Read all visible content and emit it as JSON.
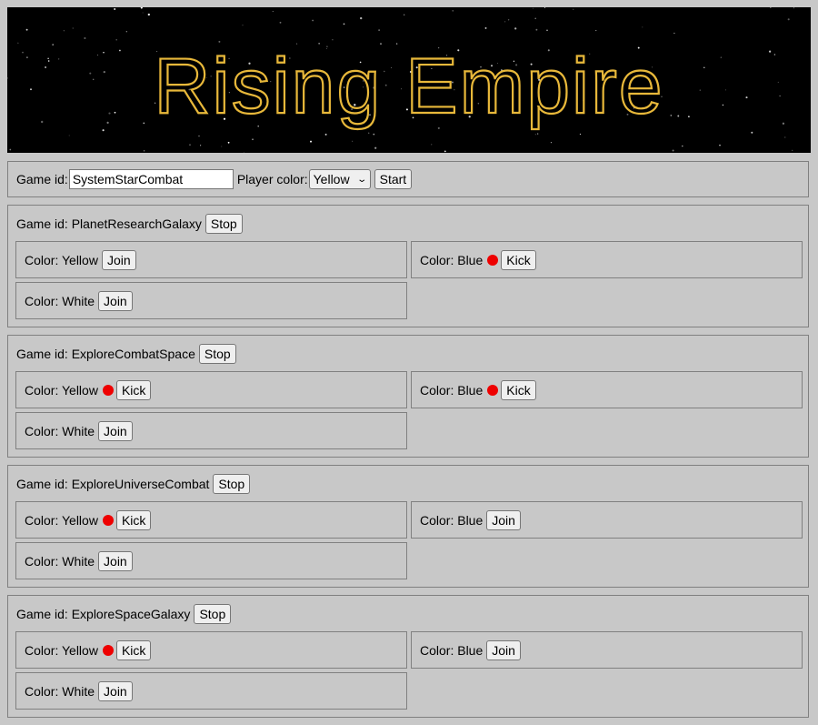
{
  "banner": {
    "title": "Rising Empire",
    "accent_color": "#e8b83a"
  },
  "new_game": {
    "game_id_label": "Game id:",
    "game_id_value": "SystemStarCombat",
    "player_color_label": "Player color:",
    "player_color_selected": "Yellow",
    "start_label": "Start"
  },
  "games": [
    {
      "label": "Game id: PlanetResearchGalaxy",
      "stop_label": "Stop",
      "slots": [
        {
          "label": "Color: Yellow",
          "occupied": false,
          "action": "Join"
        },
        {
          "label": "Color: Blue",
          "occupied": true,
          "action": "Kick"
        },
        {
          "label": "Color: White",
          "occupied": false,
          "action": "Join"
        }
      ]
    },
    {
      "label": "Game id: ExploreCombatSpace",
      "stop_label": "Stop",
      "slots": [
        {
          "label": "Color: Yellow",
          "occupied": true,
          "action": "Kick"
        },
        {
          "label": "Color: Blue",
          "occupied": true,
          "action": "Kick"
        },
        {
          "label": "Color: White",
          "occupied": false,
          "action": "Join"
        }
      ]
    },
    {
      "label": "Game id: ExploreUniverseCombat",
      "stop_label": "Stop",
      "slots": [
        {
          "label": "Color: Yellow",
          "occupied": true,
          "action": "Kick"
        },
        {
          "label": "Color: Blue",
          "occupied": false,
          "action": "Join"
        },
        {
          "label": "Color: White",
          "occupied": false,
          "action": "Join"
        }
      ]
    },
    {
      "label": "Game id: ExploreSpaceGalaxy",
      "stop_label": "Stop",
      "slots": [
        {
          "label": "Color: Yellow",
          "occupied": true,
          "action": "Kick"
        },
        {
          "label": "Color: Blue",
          "occupied": false,
          "action": "Join"
        },
        {
          "label": "Color: White",
          "occupied": false,
          "action": "Join"
        }
      ]
    }
  ],
  "status_colors": {
    "occupied_dot": "#ee0000"
  }
}
